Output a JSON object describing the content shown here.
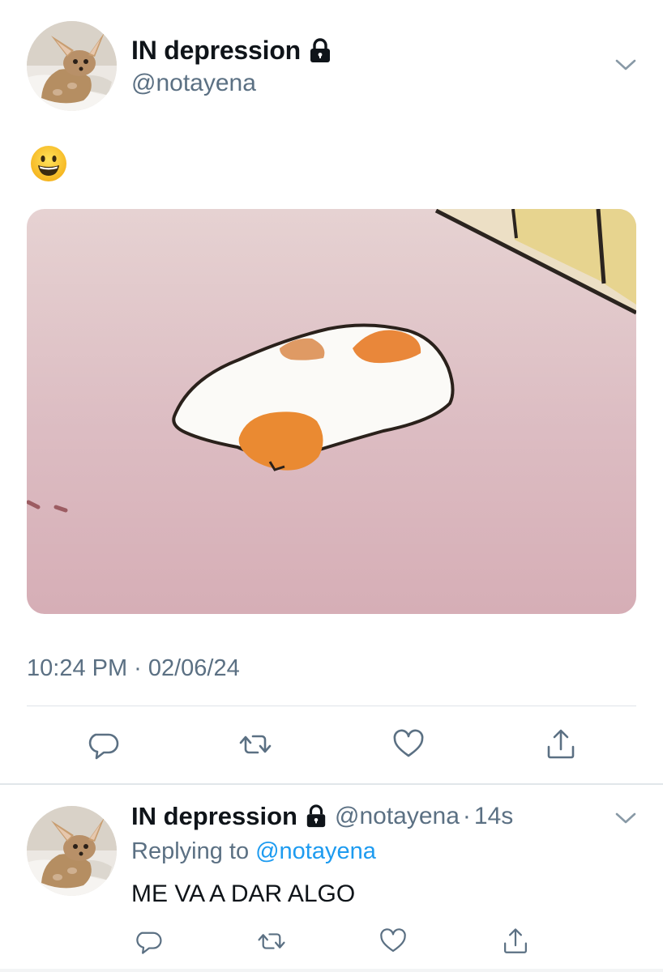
{
  "tweet": {
    "author": {
      "display_name": "IN depression",
      "handle": "@notayena",
      "avatar_icon": "fennec-fox-avatar",
      "protected_icon": "lock-icon"
    },
    "text_emoji": "grinning-face-emoji",
    "media": {
      "icon": "cartoon-cat-image",
      "background": "#dcc0c6"
    },
    "time": "10:24 PM",
    "separator": "·",
    "date": "02/06/24",
    "actions": [
      {
        "name": "reply",
        "icon": "comment-icon"
      },
      {
        "name": "retweet",
        "icon": "retweet-icon"
      },
      {
        "name": "like",
        "icon": "heart-icon"
      },
      {
        "name": "share",
        "icon": "share-icon"
      }
    ]
  },
  "reply": {
    "author": {
      "display_name": "IN depression",
      "handle": "@notayena",
      "avatar_icon": "fennec-fox-avatar",
      "protected_icon": "lock-icon"
    },
    "separator": "·",
    "age": "14s",
    "replying_to_label": "Replying to",
    "replying_to_handle": "@notayena",
    "text": "ME VA A DAR ALGO",
    "actions": [
      {
        "name": "reply",
        "icon": "comment-icon"
      },
      {
        "name": "retweet",
        "icon": "retweet-icon"
      },
      {
        "name": "like",
        "icon": "heart-icon"
      },
      {
        "name": "share",
        "icon": "share-icon"
      }
    ]
  },
  "colors": {
    "text_primary": "#0f1419",
    "text_secondary": "#5b7083",
    "link": "#1d9bf0",
    "icon": "#5b7083",
    "divider": "#dfe4e8"
  }
}
